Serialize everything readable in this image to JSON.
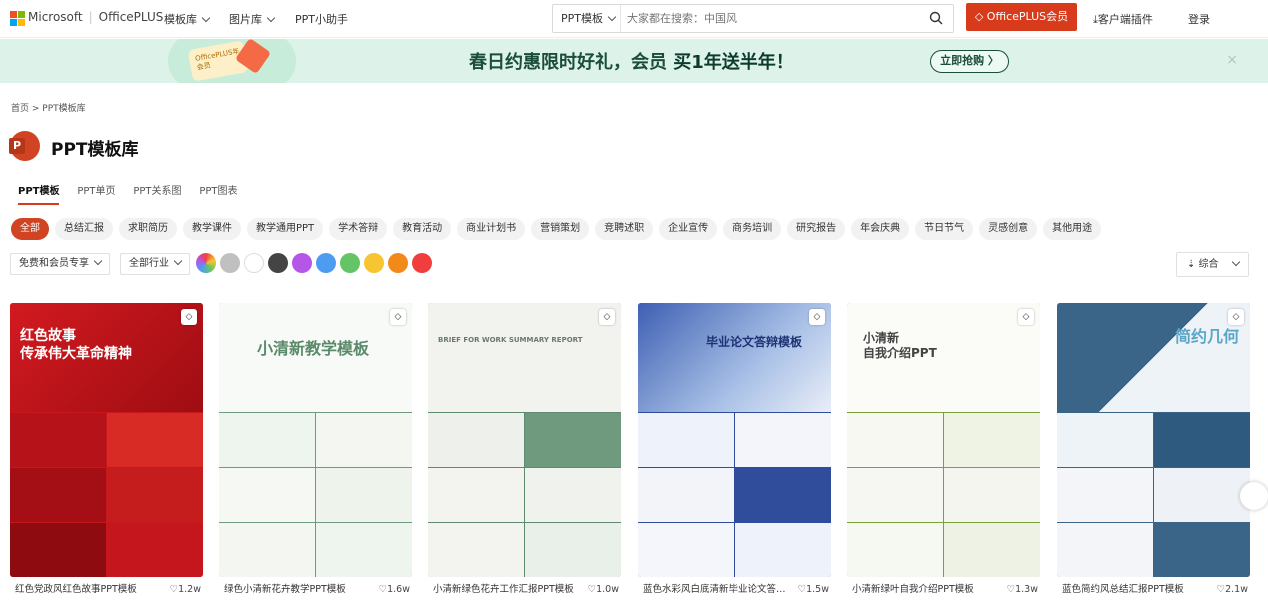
{
  "header": {
    "brand_ms": "Microsoft",
    "brand_office": "OfficePLUS",
    "nav": [
      "模板库",
      "图片库",
      "PPT小助手"
    ],
    "search": {
      "type": "PPT模板",
      "placeholder": "大家都在搜索：中国风"
    },
    "vip_button": "OfficePLUS会员",
    "client": "客户端插件",
    "login": "登录"
  },
  "banner": {
    "card_text": "OfficePLUS年会员",
    "slogan_pre": "春日约惠限时好礼，会员 ",
    "slogan_bold": "买1年送半年！",
    "button": "立即抢购 〉",
    "close": "×"
  },
  "breadcrumb": "首页 > PPT模板库",
  "title": "PPT模板库",
  "tabs": [
    "PPT模板",
    "PPT单页",
    "PPT关系图",
    "PPT图表"
  ],
  "categories": [
    "全部",
    "总结汇报",
    "求职简历",
    "教学课件",
    "教学通用PPT",
    "学术答辩",
    "教育活动",
    "商业计划书",
    "营销策划",
    "竞聘述职",
    "企业宣传",
    "商务培训",
    "研究报告",
    "年会庆典",
    "节日节气",
    "灵感创意",
    "其他用途"
  ],
  "filters": {
    "member": "免费和会员专享",
    "industry": "全部行业",
    "sort": "综合"
  },
  "colors": [
    "#conic",
    "#c0c0c0",
    "#ffffff",
    "#444444",
    "#b556e8",
    "#4d9cf2",
    "#65c466",
    "#f7c531",
    "#f28a1a",
    "#f03e3e"
  ],
  "templates": [
    {
      "name": "红色党政风红色故事PPT模板",
      "likes": "1.2w",
      "cover_text": "红色故事\n传承伟大革命精神",
      "accent": "#c8161d"
    },
    {
      "name": "绿色小清新花卉教学PPT模板",
      "likes": "1.6w",
      "cover_text": "小清新教学模板",
      "accent": "#6f9a7d"
    },
    {
      "name": "小清新绿色花卉工作汇报PPT模板",
      "likes": "1.0w",
      "cover_text": "BRIEF FOR WORK SUMMARY REPORT",
      "accent": "#5f8a6f"
    },
    {
      "name": "蓝色水彩风白底清新毕业论文答…",
      "likes": "1.5w",
      "cover_text": "毕业论文答辩模板",
      "accent": "#2f4d9a"
    },
    {
      "name": "小清新绿叶自我介绍PPT模板",
      "likes": "1.3w",
      "cover_text": "小清新\n自我介绍PPT",
      "accent": "#7aa03a"
    },
    {
      "name": "蓝色简约风总结汇报PPT模板",
      "likes": "2.1w",
      "cover_text": "简约几何",
      "accent": "#3a6488"
    }
  ]
}
